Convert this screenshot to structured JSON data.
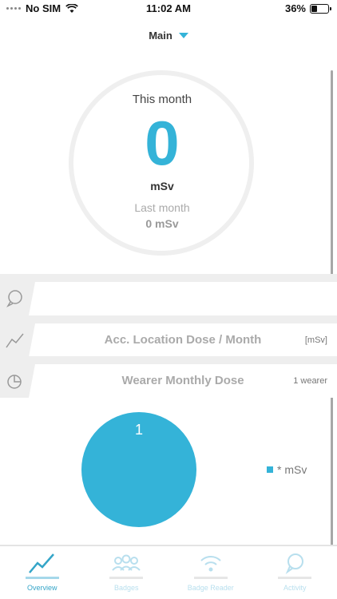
{
  "status_bar": {
    "carrier": "No SIM",
    "time": "11:02 AM",
    "battery": "36%",
    "battery_level": 0.36
  },
  "header": {
    "selector": "Main"
  },
  "dose": {
    "this_month_label": "This month",
    "this_month_value": "0",
    "unit": "mSv",
    "last_month_label": "Last month",
    "last_month_value": "0 mSv"
  },
  "sections": [
    {
      "title": "",
      "unit": "",
      "icon": "chat-bubble-icon"
    },
    {
      "title": "Acc. Location Dose / Month",
      "unit": "[mSv]",
      "icon": "line-chart-icon"
    },
    {
      "title": "Wearer Monthly Dose",
      "unit": "1 wearer",
      "icon": "pie-chart-icon"
    }
  ],
  "chart_data": {
    "type": "pie",
    "title": "Wearer Monthly Dose",
    "slices": [
      {
        "label": "1",
        "value": 1,
        "color": "#34b3d8"
      }
    ],
    "legend": [
      {
        "label": "* mSv",
        "color": "#34b3d8"
      }
    ]
  },
  "tabs": [
    {
      "label": "Overview",
      "icon": "overview-chart-icon",
      "active": true
    },
    {
      "label": "Badges",
      "icon": "badges-people-icon",
      "active": false
    },
    {
      "label": "Badge Reader",
      "icon": "wifi-reader-icon",
      "active": false
    },
    {
      "label": "Activity",
      "icon": "activity-bubble-icon",
      "active": false
    }
  ],
  "colors": {
    "accent": "#34b3d8",
    "band_bg": "#eeeeee",
    "muted_text": "#aaaaaa"
  }
}
